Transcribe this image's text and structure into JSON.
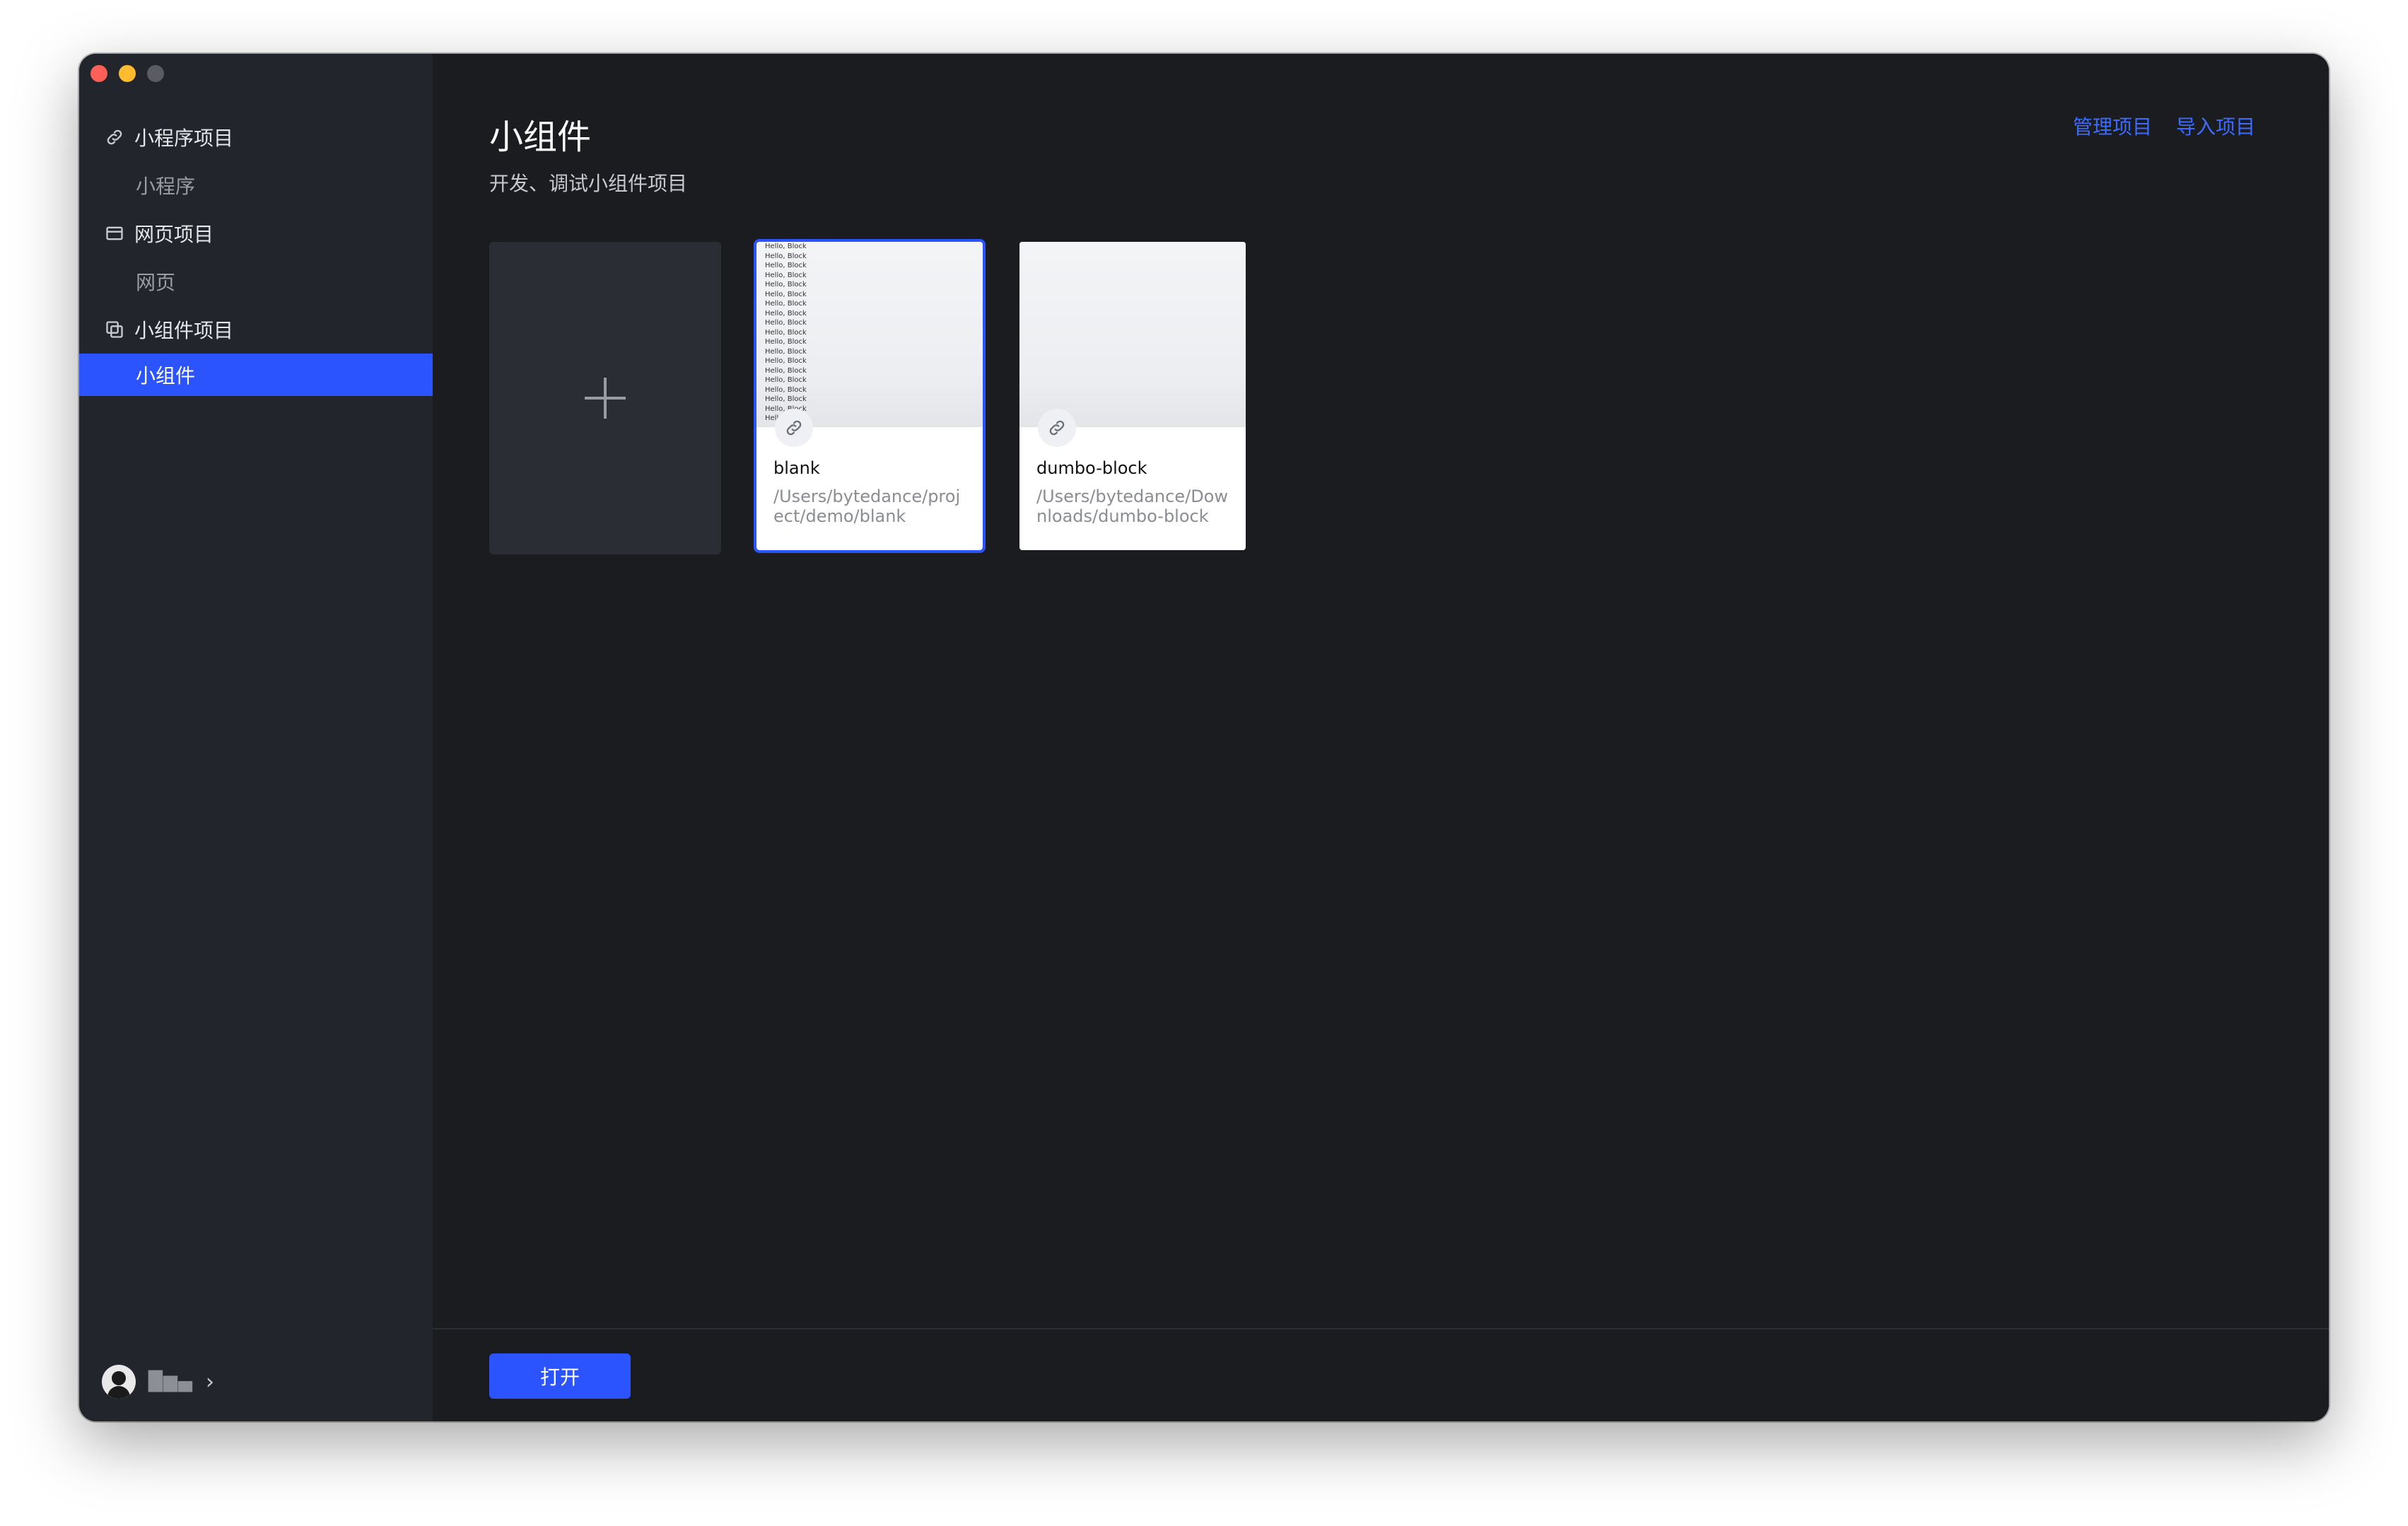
{
  "window": {
    "colors": {
      "sidebar": "#23252c",
      "main": "#1a1c20",
      "accent": "#2b54ff",
      "link": "#3c6cff"
    }
  },
  "sidebar": {
    "groups": [
      {
        "label": "小程序项目",
        "icon": "link-icon",
        "items": [
          {
            "label": "小程序",
            "active": false
          }
        ]
      },
      {
        "label": "网页项目",
        "icon": "browser-window-icon",
        "items": [
          {
            "label": "网页",
            "active": false
          }
        ]
      },
      {
        "label": "小组件项目",
        "icon": "widget-copy-icon",
        "items": [
          {
            "label": "小组件",
            "active": true
          }
        ]
      }
    ],
    "user": {
      "name": "█▆▄"
    }
  },
  "header": {
    "title": "小组件",
    "subtitle": "开发、调试小组件项目",
    "links": [
      "管理项目",
      "导入项目"
    ]
  },
  "projects": [
    {
      "name": "blank",
      "path": "/Users/bytedance/project/demo/blank",
      "selected": true,
      "preview_lines": [
        "Hello, Block",
        "Hello, Block",
        "Hello, Block",
        "Hello, Block",
        "Hello, Block",
        "Hello, Block",
        "Hello, Block",
        "Hello, Block",
        "Hello, Block",
        "Hello, Block",
        "Hello, Block",
        "Hello, Block",
        "Hello, Block",
        "Hello, Block",
        "Hello, Block",
        "Hello, Block",
        "Hello, Block",
        "Hello, Block",
        "Hello, Block"
      ]
    },
    {
      "name": "dumbo-block",
      "path": "/Users/bytedance/Downloads/dumbo-block",
      "selected": false,
      "preview_lines": []
    }
  ],
  "footer": {
    "open_label": "打开"
  }
}
